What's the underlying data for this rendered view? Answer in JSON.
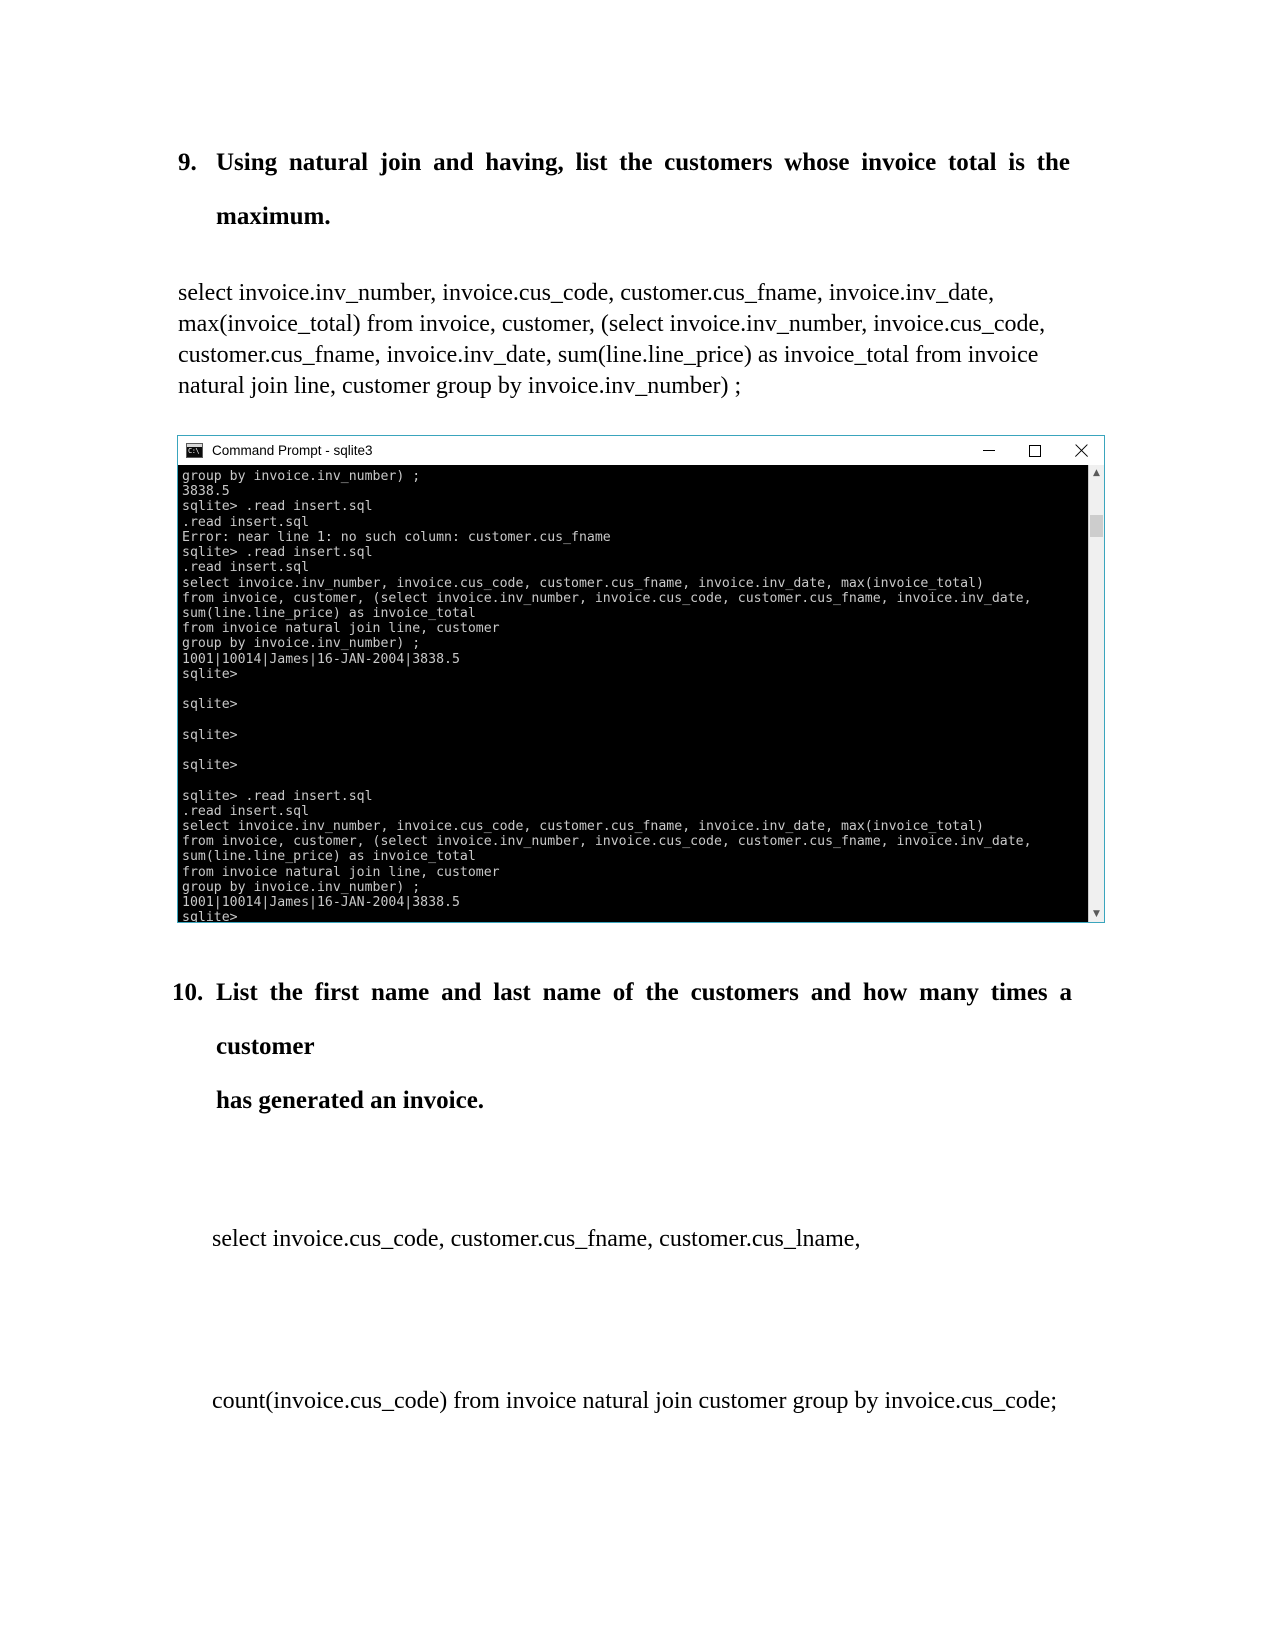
{
  "document": {
    "questions": [
      {
        "number": "9.",
        "line1": "Using natural join and having, list the customers whose invoice total is the",
        "line2": "maximum.",
        "answer": "select invoice.inv_number, invoice.cus_code, customer.cus_fname, invoice.inv_date, max(invoice_total) from invoice, customer, (select invoice.inv_number, invoice.cus_code, customer.cus_fname, invoice.inv_date, sum(line.line_price) as invoice_total from invoice natural join line, customer group by invoice.inv_number) ;"
      },
      {
        "number": "10.",
        "line1": "List the first name and last name of the customers and how many times a customer",
        "line2": "has generated an invoice.",
        "answer_line1": "select invoice.cus_code, customer.cus_fname, customer.cus_lname,",
        "answer_line2": "count(invoice.cus_code) from invoice natural join customer group by invoice.cus_code;"
      }
    ]
  },
  "terminal_window": {
    "title": "Command Prompt - sqlite3",
    "icon": "cmd-icon",
    "controls": {
      "minimize": "minimize-button",
      "maximize": "maximize-button",
      "close": "close-button"
    },
    "scrollbar": {
      "up_arrow": "▲",
      "down_arrow": "▼"
    },
    "colors": {
      "background": "#000000",
      "text": "#c8c8c8",
      "border": "#3aa5bd"
    },
    "lines": [
      "group by invoice.inv_number) ;",
      "3838.5",
      "sqlite> .read insert.sql",
      ".read insert.sql",
      "Error: near line 1: no such column: customer.cus_fname",
      "sqlite> .read insert.sql",
      ".read insert.sql",
      "select invoice.inv_number, invoice.cus_code, customer.cus_fname, invoice.inv_date, max(invoice_total)",
      "from invoice, customer, (select invoice.inv_number, invoice.cus_code, customer.cus_fname, invoice.inv_date,",
      "sum(line.line_price) as invoice_total",
      "from invoice natural join line, customer",
      "group by invoice.inv_number) ;",
      "1001|10014|James|16-JAN-2004|3838.5",
      "sqlite>",
      "",
      "sqlite>",
      "",
      "sqlite>",
      "",
      "sqlite>",
      "",
      "sqlite> .read insert.sql",
      ".read insert.sql",
      "select invoice.inv_number, invoice.cus_code, customer.cus_fname, invoice.inv_date, max(invoice_total)",
      "from invoice, customer, (select invoice.inv_number, invoice.cus_code, customer.cus_fname, invoice.inv_date,",
      "sum(line.line_price) as invoice_total",
      "from invoice natural join line, customer",
      "group by invoice.inv_number) ;",
      "1001|10014|James|16-JAN-2004|3838.5",
      "sqlite>"
    ]
  }
}
